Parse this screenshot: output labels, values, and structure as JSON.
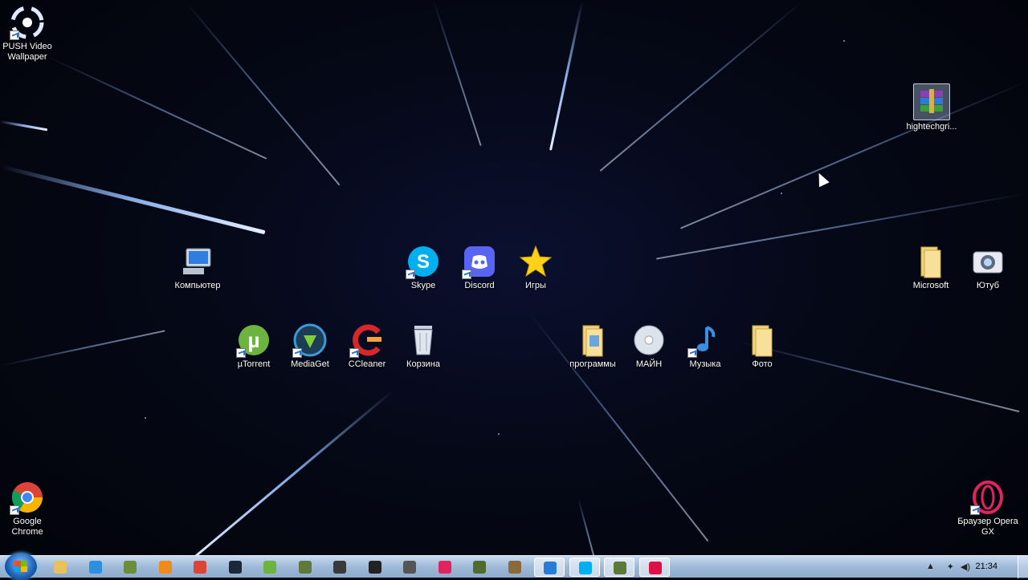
{
  "desktop": {
    "icons": [
      {
        "name": "push-video-wallpaper",
        "label": "PUSH Video Wallpaper",
        "icon": "push-video-icon"
      },
      {
        "name": "hightechgrid",
        "label": "hightechgri...",
        "icon": "winrar-archive-icon"
      },
      {
        "name": "computer",
        "label": "Компьютер",
        "icon": "computer-icon"
      },
      {
        "name": "skype",
        "label": "Skype",
        "icon": "skype-icon"
      },
      {
        "name": "discord",
        "label": "Discord",
        "icon": "discord-icon"
      },
      {
        "name": "games",
        "label": "Игры",
        "icon": "star-icon"
      },
      {
        "name": "microsoft",
        "label": "Microsoft",
        "icon": "folder-icon"
      },
      {
        "name": "youtube",
        "label": "Ютуб",
        "icon": "camera-icon"
      },
      {
        "name": "utorrent",
        "label": "µTorrent",
        "icon": "utorrent-icon"
      },
      {
        "name": "mediaget",
        "label": "MediaGet",
        "icon": "mediaget-icon"
      },
      {
        "name": "ccleaner",
        "label": "CCleaner",
        "icon": "ccleaner-icon"
      },
      {
        "name": "recycle-bin",
        "label": "Корзина",
        "icon": "recycle-bin-icon"
      },
      {
        "name": "programs",
        "label": "программы",
        "icon": "folder-icon"
      },
      {
        "name": "main",
        "label": "МАЙН",
        "icon": "disc-icon"
      },
      {
        "name": "music",
        "label": "Музыка",
        "icon": "music-icon"
      },
      {
        "name": "photo",
        "label": "Фото",
        "icon": "folder-icon"
      },
      {
        "name": "google-chrome",
        "label": "Google Chrome",
        "icon": "chrome-icon"
      },
      {
        "name": "opera-gx",
        "label": "Браузер Opera GX",
        "icon": "opera-icon"
      }
    ]
  },
  "taskbar": {
    "clock": "21:34",
    "pinned": [
      {
        "name": "explorer",
        "icon": "folder-icon",
        "color": "#e8c15a"
      },
      {
        "name": "internet-explorer",
        "icon": "ie-icon",
        "color": "#2c8fe0"
      },
      {
        "name": "minecraft",
        "icon": "minecraft-icon",
        "color": "#6b8e3a"
      },
      {
        "name": "media-player",
        "icon": "media-player-icon",
        "color": "#f08a1c"
      },
      {
        "name": "chrome",
        "icon": "chrome-icon",
        "color": "#db4437"
      },
      {
        "name": "steam",
        "icon": "steam-icon",
        "color": "#1b2838"
      },
      {
        "name": "utorrent",
        "icon": "utorrent-icon",
        "color": "#6db33f"
      },
      {
        "name": "minecraft-2",
        "icon": "block-icon",
        "color": "#5d7a3a"
      },
      {
        "name": "cs",
        "icon": "cs-icon",
        "color": "#3a3a3a"
      },
      {
        "name": "game",
        "icon": "chess-icon",
        "color": "#222222"
      },
      {
        "name": "calculator",
        "icon": "calculator-icon",
        "color": "#555555"
      },
      {
        "name": "opera",
        "icon": "opera-icon",
        "color": "#e0245e"
      },
      {
        "name": "minecraft-3",
        "icon": "block-icon",
        "color": "#4f6b2f"
      },
      {
        "name": "minecraft-4",
        "icon": "block-icon",
        "color": "#8a6a3a"
      },
      {
        "name": "app-blue",
        "icon": "globe-icon",
        "color": "#2a7bd6"
      },
      {
        "name": "skype",
        "icon": "skype-icon",
        "color": "#00aff0"
      },
      {
        "name": "minecraft-5",
        "icon": "block-icon",
        "color": "#5a7a3a"
      },
      {
        "name": "paint",
        "icon": "paint-icon",
        "color": "#d14"
      }
    ]
  }
}
